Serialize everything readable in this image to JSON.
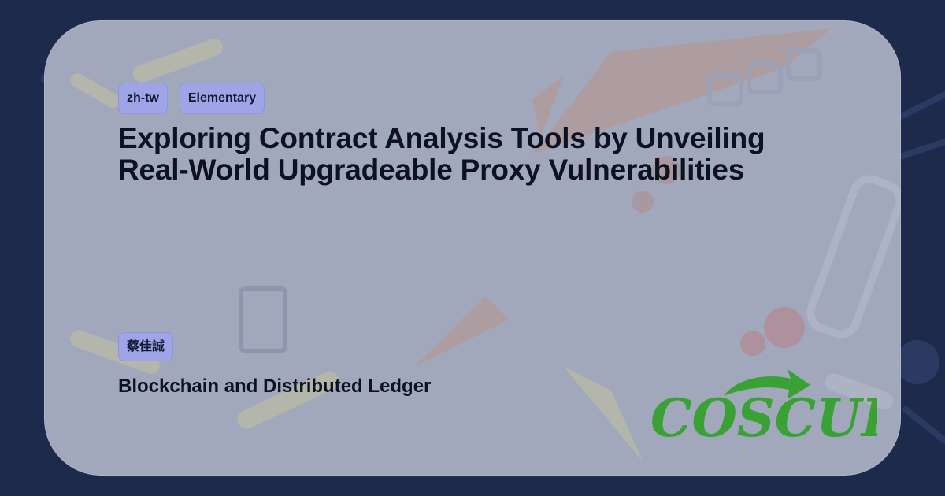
{
  "tags": [
    "zh-tw",
    "Elementary"
  ],
  "title_line1": "Exploring Contract Analysis Tools by Unveiling",
  "title_line2": "Real-World Upgradeable Proxy Vulnerabilities",
  "speaker": "蔡佳誠",
  "track": "Blockchain and Distributed Ledger",
  "logo_text": "COSCUP",
  "colors": {
    "background": "#1d2a4c",
    "tag": "#9fa4e6",
    "logo_green": "#3aa235"
  }
}
